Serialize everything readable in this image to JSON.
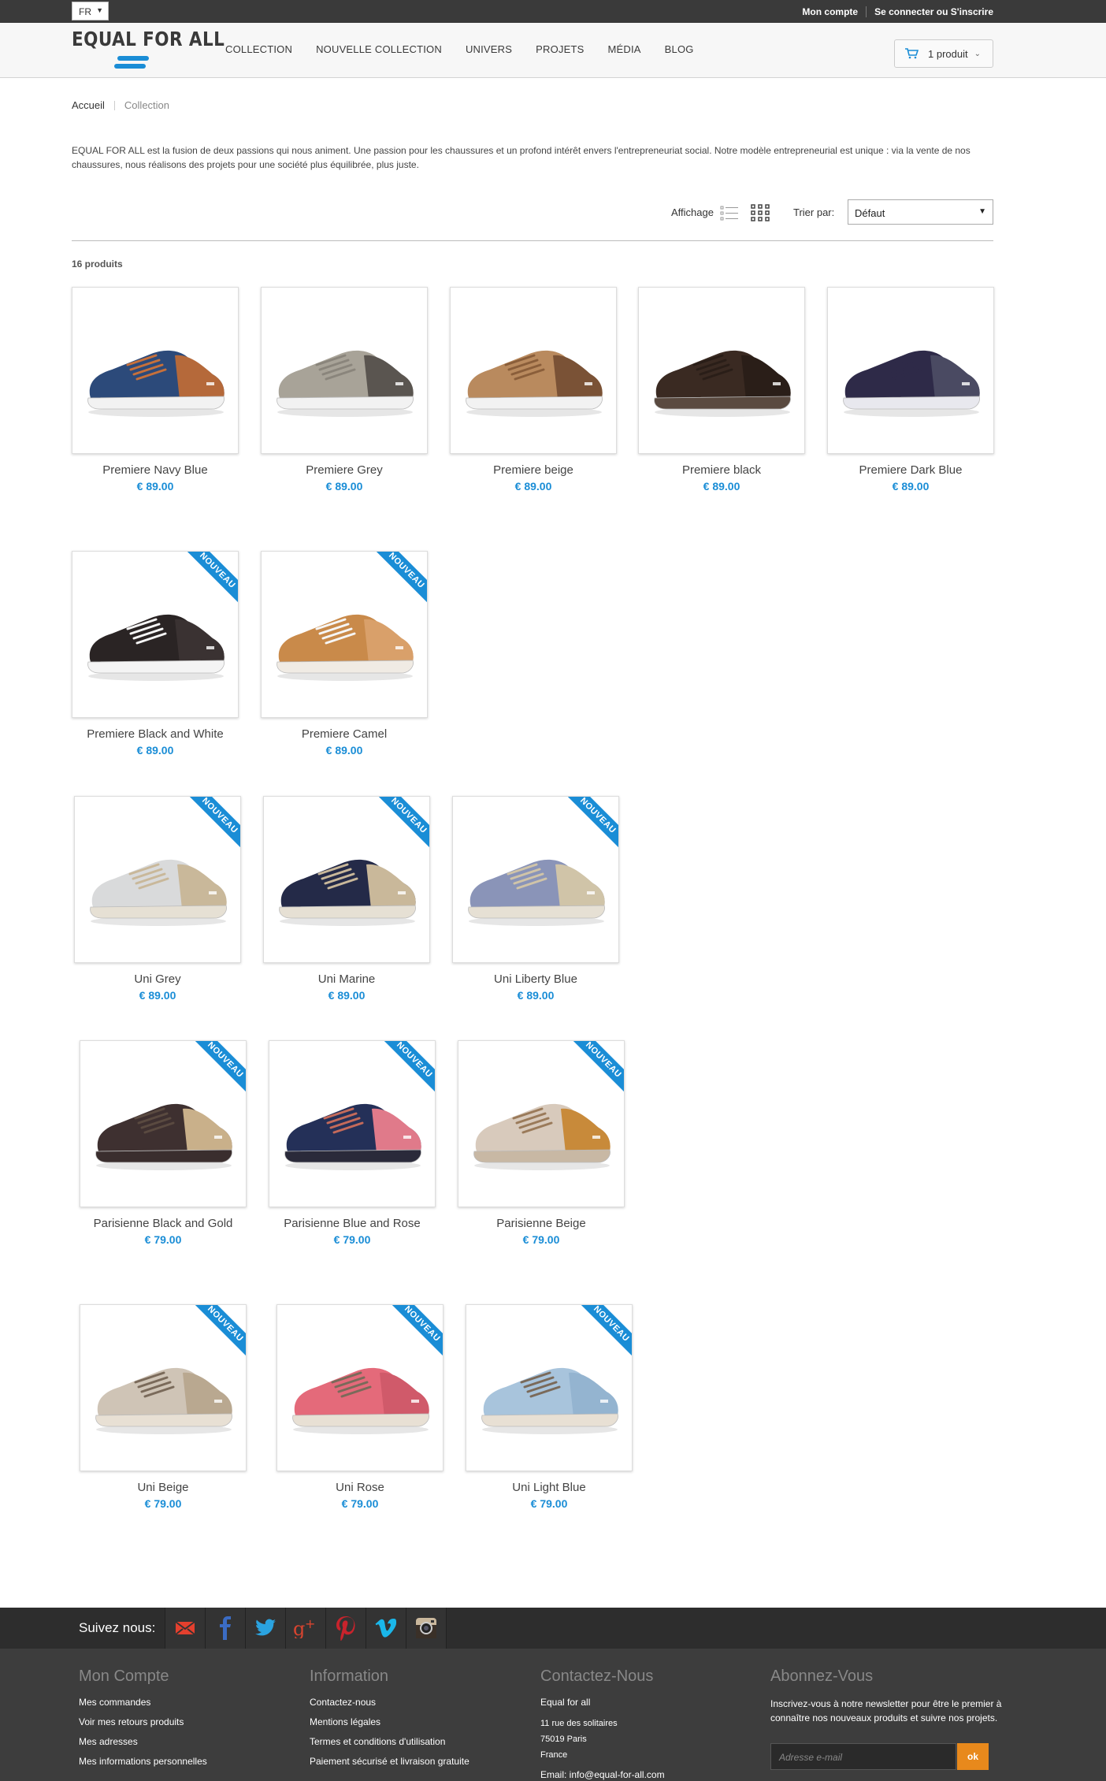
{
  "topbar": {
    "language": "FR",
    "my_account": "Mon compte",
    "login": "Se connecter ou S'inscrire"
  },
  "header": {
    "logo_text": "EQUAL FOR ALL",
    "nav": [
      "COLLECTION",
      "NOUVELLE COLLECTION",
      "UNIVERS",
      "PROJETS",
      "MÉDIA",
      "BLOG"
    ],
    "cart_label": "1 produit"
  },
  "breadcrumb": {
    "home": "Accueil",
    "current": "Collection"
  },
  "intro": "EQUAL FOR ALL est la fusion de deux passions qui nous animent. Une passion pour les chaussures et un profond intérêt envers l'entrepreneuriat social. Notre modèle entrepreneurial est unique : via la vente de nos chaussures, nous réalisons des projets pour une société plus équilibrée, plus juste.",
  "toolbar": {
    "display_label": "Affichage",
    "sort_label": "Trier par:",
    "sort_value": "Défaut",
    "count": "16 produits"
  },
  "badge": "NOUVEAU",
  "products": [
    {
      "name": "Premiere Navy Blue",
      "price": "€ 89.00",
      "new": false,
      "upper": "#2c4a7a",
      "accent": "#b5693a",
      "sole": "#f2f2f2",
      "laces": "#c7703a"
    },
    {
      "name": "Premiere Grey",
      "price": "€ 89.00",
      "new": false,
      "upper": "#a8a398",
      "accent": "#5a5550",
      "sole": "#f2f2f2",
      "laces": "#8a857c"
    },
    {
      "name": "Premiere beige",
      "price": "€ 89.00",
      "new": false,
      "upper": "#b98a5e",
      "accent": "#7a5236",
      "sole": "#f2f2f2",
      "laces": "#8a5e3a"
    },
    {
      "name": "Premiere black",
      "price": "€ 89.00",
      "new": false,
      "upper": "#3a2a22",
      "accent": "#2a1e18",
      "sole": "#5a4a40",
      "laces": "#2a1e18"
    },
    {
      "name": "Premiere Dark Blue",
      "price": "€ 89.00",
      "new": false,
      "upper": "#2e2a48",
      "accent": "#4a4a62",
      "sole": "#e8e8ee",
      "laces": "#2e2a48"
    },
    {
      "name": "Premiere Black and White",
      "price": "€ 89.00",
      "new": true,
      "upper": "#2a2424",
      "accent": "#3a3232",
      "sole": "#f4f4f4",
      "laces": "#f6f6f6"
    },
    {
      "name": "Premiere Camel",
      "price": "€ 89.00",
      "new": true,
      "upper": "#c98a4a",
      "accent": "#d9a06a",
      "sole": "#f0ebe4",
      "laces": "#f6f6f6"
    },
    {
      "name": "Uni Grey",
      "price": "€ 89.00",
      "new": true,
      "upper": "#d9dadb",
      "accent": "#c9b89a",
      "sole": "#e6e0d4",
      "laces": "#c9b89a"
    },
    {
      "name": "Uni Marine",
      "price": "€ 89.00",
      "new": true,
      "upper": "#242a48",
      "accent": "#c9b89a",
      "sole": "#e6e0d4",
      "laces": "#c9b89a"
    },
    {
      "name": "Uni Liberty Blue",
      "price": "€ 89.00",
      "new": true,
      "upper": "#8a94b8",
      "accent": "#d0c4a8",
      "sole": "#e6e0d4",
      "laces": "#d0c4a8"
    },
    {
      "name": "Parisienne Black and Gold",
      "price": "€ 79.00",
      "new": true,
      "upper": "#3e3030",
      "accent": "#c9b08a",
      "sole": "#3a2e2e",
      "laces": "#5a4a40"
    },
    {
      "name": "Parisienne Blue and Rose",
      "price": "€ 79.00",
      "new": true,
      "upper": "#243058",
      "accent": "#e07a8a",
      "sole": "#2a2a3a",
      "laces": "#c46a5a"
    },
    {
      "name": "Parisienne Beige",
      "price": "€ 79.00",
      "new": true,
      "upper": "#d8cabc",
      "accent": "#c88a3a",
      "sole": "#c8b8a4",
      "laces": "#9a7a5a"
    },
    {
      "name": "Uni Beige",
      "price": "€ 79.00",
      "new": true,
      "upper": "#cfc4b6",
      "accent": "#b9a890",
      "sole": "#e8e0d4",
      "laces": "#7a6a5a"
    },
    {
      "name": "Uni Rose",
      "price": "€ 79.00",
      "new": true,
      "upper": "#e46a7a",
      "accent": "#d05a6a",
      "sole": "#e8e0d4",
      "laces": "#7a6a5a"
    },
    {
      "name": "Uni Light Blue",
      "price": "€ 79.00",
      "new": true,
      "upper": "#a8c4dc",
      "accent": "#94b4d0",
      "sole": "#e8e0d4",
      "laces": "#7a6a5a"
    }
  ],
  "footer": {
    "follow_label": "Suivez nous:",
    "social": [
      "mail-icon",
      "facebook-icon",
      "twitter-icon",
      "googleplus-icon",
      "pinterest-icon",
      "vimeo-icon",
      "instagram-icon"
    ],
    "account": {
      "title": "Mon Compte",
      "links": [
        "Mes commandes",
        "Voir mes retours produits",
        "Mes adresses",
        "Mes informations personnelles"
      ]
    },
    "information": {
      "title": "Information",
      "links": [
        "Contactez-nous",
        "Mentions légales",
        "Termes et conditions d'utilisation",
        "Paiement sécurisé et livraison gratuite"
      ]
    },
    "contact": {
      "title": "Contactez-Nous",
      "company": "Equal for all",
      "address": [
        "11 rue des solitaires",
        "75019 Paris",
        "France"
      ],
      "email": "Email: info@equal-for-all.com"
    },
    "newsletter": {
      "title": "Abonnez-Vous",
      "text": "Inscrivez-vous à notre newsletter pour être le premier à connaître nos nouveaux produits et suivre nos projets.",
      "placeholder": "Adresse e-mail",
      "button": "ok"
    }
  }
}
